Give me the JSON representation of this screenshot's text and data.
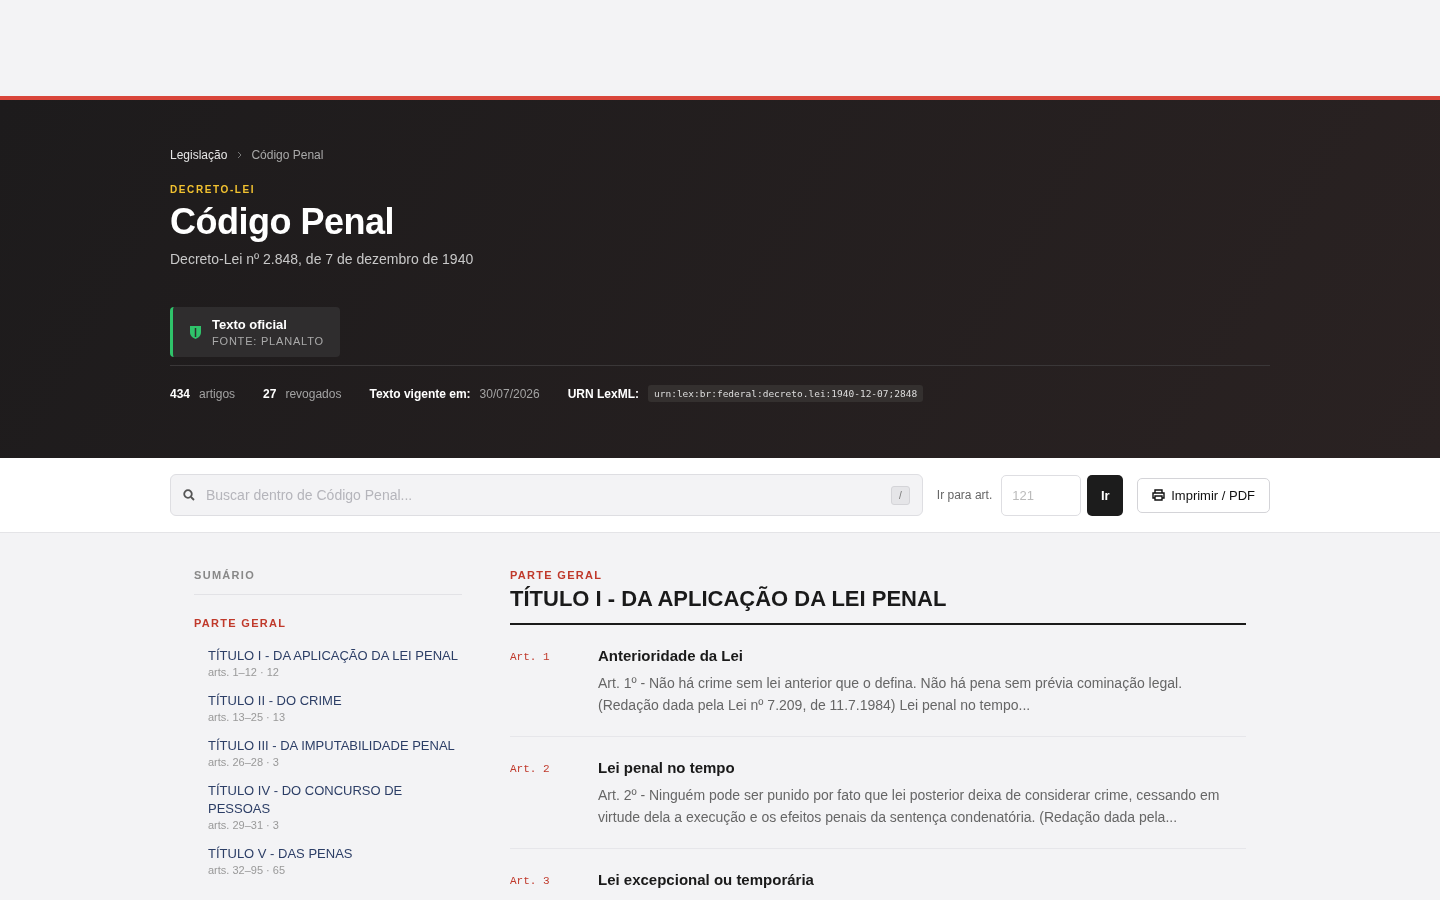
{
  "breadcrumb": [
    {
      "label": "Legislação",
      "current": false
    },
    {
      "label": "Código Penal",
      "current": true
    }
  ],
  "header": {
    "kind_label": "DECRETO-LEI",
    "title": "Código Penal",
    "subtitle": "Decreto-Lei nº 2.848, de 7 de dezembro de 1940",
    "badge": {
      "title": "Texto oficial",
      "source": "FONTE: PLANALTO"
    }
  },
  "stats": [
    {
      "kind": "count",
      "value": "434",
      "label": "artigos"
    },
    {
      "kind": "count",
      "value": "27",
      "label": "revogados"
    },
    {
      "kind": "pair",
      "value": "Texto vigente em:",
      "label": "30/07/2026"
    },
    {
      "kind": "code",
      "value": "URN LexML:",
      "label": "urn:lex:br:federal:decreto.lei:1940-12-07;2848"
    }
  ],
  "toolbar": {
    "search_placeholder": "Buscar dentro de Código Penal...",
    "shortcut": "/",
    "goto_label": "Ir para art.",
    "goto_placeholder": "121",
    "goto_button": "Ir",
    "print_button": "Imprimir / PDF"
  },
  "sidebar": {
    "title": "SUMÁRIO",
    "section": "PARTE GERAL",
    "items": [
      {
        "label": "TÍTULO I - DA APLICAÇÃO DA LEI PENAL",
        "meta": "arts. 1–12 · 12"
      },
      {
        "label": "TÍTULO II - DO CRIME",
        "meta": "arts. 13–25 · 13"
      },
      {
        "label": "TÍTULO III - DA IMPUTABILIDADE PENAL",
        "meta": "arts. 26–28 · 3"
      },
      {
        "label": "TÍTULO IV - DO CONCURSO DE PESSOAS",
        "meta": "arts. 29–31 · 3"
      },
      {
        "label": "TÍTULO V - DAS PENAS",
        "meta": "arts. 32–95 · 65"
      }
    ]
  },
  "main": {
    "section": "PARTE GERAL",
    "title": "TÍTULO I - DA APLICAÇÃO DA LEI PENAL",
    "articles": [
      {
        "number": "Art. 1",
        "title": "Anterioridade da Lei",
        "text": "Art. 1º - Não há crime sem lei anterior que o defina. Não há pena sem prévia cominação legal. (Redação dada pela Lei nº 7.209, de 11.7.1984) Lei penal no tempo..."
      },
      {
        "number": "Art. 2",
        "title": "Lei penal no tempo",
        "text": "Art. 2º - Ninguém pode ser punido por fato que lei posterior deixa de considerar crime, cessando em virtude dela a execução e os efeitos penais da sentença condenatória. (Redação dada pela..."
      },
      {
        "number": "Art. 3",
        "title": "Lei excepcional ou temporária"
      }
    ]
  }
}
